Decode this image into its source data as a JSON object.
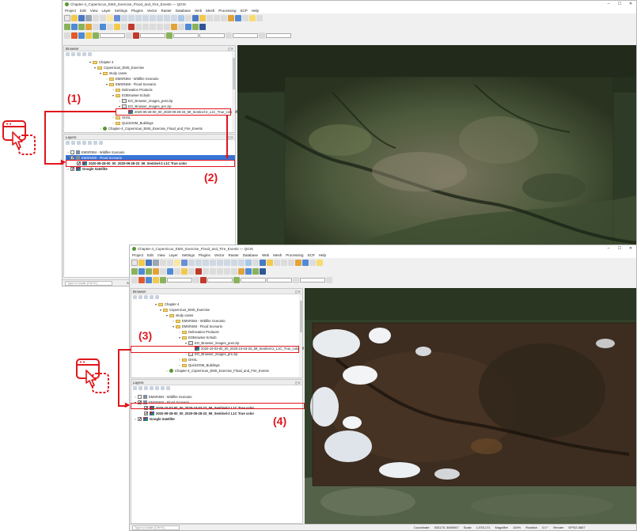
{
  "window1": {
    "title": "Chapter-4_Copernicus_EMS_Exercise_Flood_and_Fire_Events — QGIS",
    "menu": [
      "Project",
      "Edit",
      "View",
      "Layer",
      "Settings",
      "Plugins",
      "Vector",
      "Raster",
      "Database",
      "Web",
      "Mesh",
      "Processing",
      "SCP",
      "Help"
    ],
    "browser_panel": "Browser",
    "layers_panel": "Layers",
    "browser_items": [
      {
        "label": "Chapter 4"
      },
      {
        "label": "Copernicus_EMS_Exercise"
      },
      {
        "label": "study cases"
      },
      {
        "label": "EMSR384 - Wildfire Scenario"
      },
      {
        "label": "EMSR460 - Flood Scenario"
      },
      {
        "label": "Delineation Products"
      },
      {
        "label": "EOBrowser-Schuib"
      },
      {
        "label": "EO_Browser_images_post.zip"
      },
      {
        "label": "EO_Browser_images_pre.zip"
      },
      {
        "label": "2020-09-28-00_00_2020-09-28-23_59_Sentinel-2_L1C_True_color.tiff"
      },
      {
        "label": "GHSL"
      },
      {
        "label": "QuickOSM_Buildings"
      },
      {
        "label": "Chapter-4_Copernicus_EMS_Exercise_Flood_and_Fire_Events"
      }
    ],
    "layers": [
      {
        "label": "EMSR384 - Wildfire Scenario"
      },
      {
        "label": "EMSR460 - Flood Scenario"
      },
      {
        "label": "2020-09-28-00_00_2020-09-28-23_59_Sentinel-2 L1C True color"
      },
      {
        "label": "Google Satellite"
      }
    ],
    "locate_placeholder": "Type to locate (Ctrl+K)",
    "status_fragment": "Sta"
  },
  "window2": {
    "title": "Chapter-4_Copernicus_EMS_Exercise_Flood_and_Fire_Events — QGIS",
    "menu": [
      "Project",
      "Edit",
      "View",
      "Layer",
      "Settings",
      "Plugins",
      "Vector",
      "Raster",
      "Database",
      "Web",
      "Mesh",
      "Processing",
      "SCP",
      "Help"
    ],
    "browser_panel": "Browser",
    "layers_panel": "Layers",
    "browser_items": [
      {
        "label": "Chapter 4"
      },
      {
        "label": "Copernicus_EMS_Exercise"
      },
      {
        "label": "study cases"
      },
      {
        "label": "EMSR384 - Wildfire Scenario"
      },
      {
        "label": "EMSR460 - Flood Scenario"
      },
      {
        "label": "Delineation Products"
      },
      {
        "label": "EOBrowser-Schuib"
      },
      {
        "label": "EO_Browser_images_post.zip"
      },
      {
        "label": "2020-10-03-00_00_2020-10-03-23_59_Sentinel-2_L1C_True_color.tiff"
      },
      {
        "label": "EO_Browser_images_pre.zip"
      },
      {
        "label": "GHSL"
      },
      {
        "label": "QuickOSM_Buildings"
      },
      {
        "label": "Chapter-4_Copernicus_EMS_Exercise_Flood_and_Fire_Events"
      }
    ],
    "layers": [
      {
        "label": "EMSR384 - Wildfire Scenario"
      },
      {
        "label": "EMSR460 - Flood Scenario"
      },
      {
        "label": "2020-10-03-00_00_2020-10-03-23_59_Sentinel-2 L1C True color"
      },
      {
        "label": "2020-09-28-00_00_2020-09-28-23_59_Sentinel-2 L1C True color"
      },
      {
        "label": "Google Satellite"
      }
    ],
    "locate_placeholder": "Type to locate (Ctrl+K)",
    "status": {
      "coordinate_label": "Coordinate",
      "coordinate_value": "933175, 5690067",
      "scale_label": "Scale",
      "scale_value": "1:378,171",
      "magnifier_label": "Magnifier",
      "magnifier_value": "100%",
      "rotation_label": "Rotation",
      "rotation_value": "0.0 °",
      "render_label": "Render",
      "crs": "EPSG:3857"
    }
  },
  "annotations": {
    "step1": "(1)",
    "step2": "(2)",
    "step3": "(3)",
    "step4": "(4)"
  },
  "colors": {
    "annotation_red": "#e0161c",
    "qgis_green": "#589632",
    "selection_blue": "#3874d8"
  }
}
